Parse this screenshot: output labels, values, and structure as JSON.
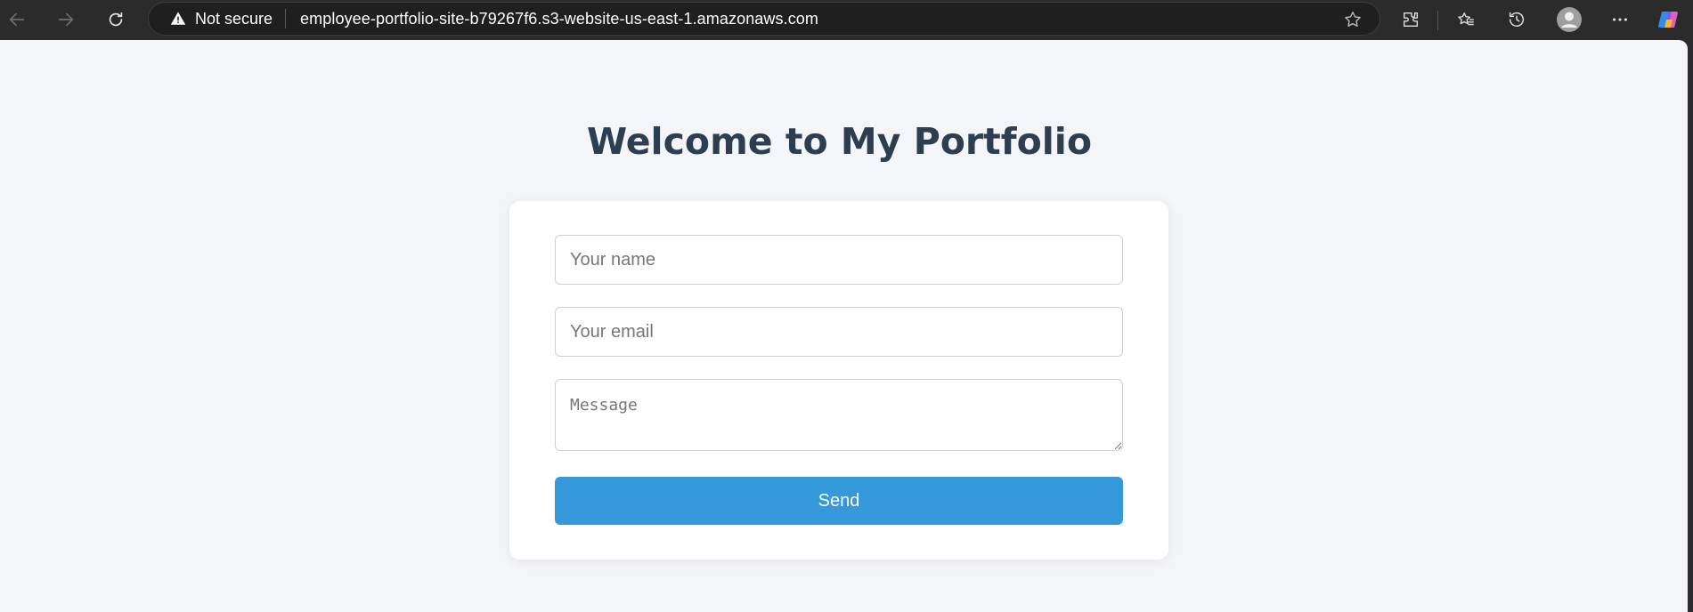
{
  "browser": {
    "security_label": "Not secure",
    "url": "employee-portfolio-site-b79267f6.s3-website-us-east-1.amazonaws.com",
    "icons": [
      "back-icon",
      "forward-icon",
      "refresh-icon",
      "warning-icon",
      "star-icon",
      "extensions-icon",
      "favorites-icon",
      "history-icon",
      "profile-icon",
      "more-icon",
      "copilot-icon"
    ]
  },
  "page": {
    "title": "Welcome to My Portfolio"
  },
  "form": {
    "name_placeholder": "Your name",
    "email_placeholder": "Your email",
    "message_placeholder": "Message",
    "send_label": "Send"
  },
  "colors": {
    "heading": "#2c3e50",
    "button": "#3498db",
    "background": "#f4f5f9"
  }
}
